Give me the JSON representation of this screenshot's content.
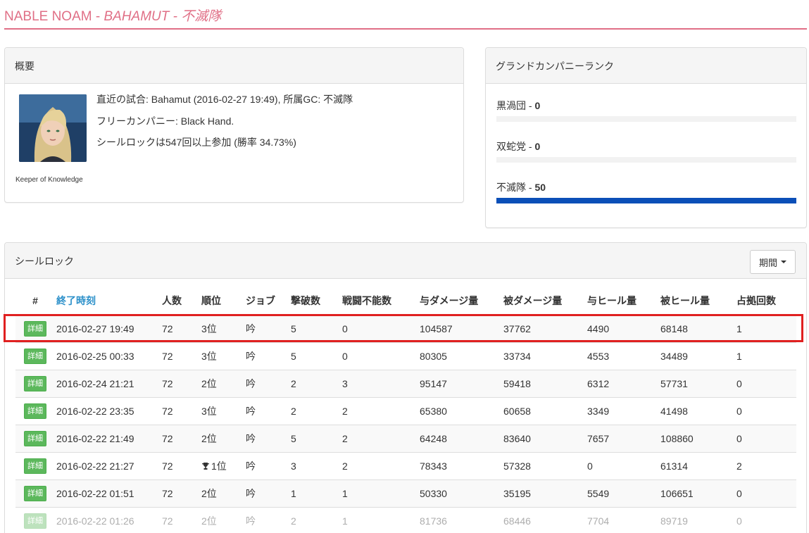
{
  "header": {
    "name": "NABLE NOAM - ",
    "datacenter": "BAHAMUT - 不滅隊"
  },
  "overview": {
    "title": "概要",
    "last_match": "直近の試合: Bahamut (2016-02-27 19:49), 所属GC: 不滅隊",
    "free_company": "フリーカンパニー: Black Hand.",
    "participation": "シールロックは547回以上参加 (勝率 34.73%)",
    "player_title": "Keeper of Knowledge"
  },
  "gc_rank": {
    "title": "グランドカンパニーランク",
    "items": [
      {
        "label": "黒渦団 - ",
        "value": "0",
        "fill": 0
      },
      {
        "label": "双蛇党 - ",
        "value": "0",
        "fill": 0
      },
      {
        "label": "不滅隊 - ",
        "value": "50",
        "fill": 1.0
      }
    ],
    "bar_color": "#0b4fb8"
  },
  "seal_rock": {
    "title": "シールロック",
    "period_label": "期間",
    "columns": [
      "#",
      "終了時刻",
      "人数",
      "順位",
      "ジョブ",
      "撃破数",
      "戦闘不能数",
      "与ダメージ量",
      "被ダメージ量",
      "与ヒール量",
      "被ヒール量",
      "占拠回数"
    ],
    "detail_label": "詳細",
    "rows": [
      {
        "time": "2016-02-27 19:49",
        "players": "72",
        "rank": "3位",
        "trophy": false,
        "job": "吟",
        "kills": "5",
        "deaths": "0",
        "dmg_dealt": "104587",
        "dmg_taken": "37762",
        "heal_dealt": "4490",
        "heal_taken": "68148",
        "captures": "1"
      },
      {
        "time": "2016-02-25 00:33",
        "players": "72",
        "rank": "3位",
        "trophy": false,
        "job": "吟",
        "kills": "5",
        "deaths": "0",
        "dmg_dealt": "80305",
        "dmg_taken": "33734",
        "heal_dealt": "4553",
        "heal_taken": "34489",
        "captures": "1"
      },
      {
        "time": "2016-02-24 21:21",
        "players": "72",
        "rank": "2位",
        "trophy": false,
        "job": "吟",
        "kills": "2",
        "deaths": "3",
        "dmg_dealt": "95147",
        "dmg_taken": "59418",
        "heal_dealt": "6312",
        "heal_taken": "57731",
        "captures": "0"
      },
      {
        "time": "2016-02-22 23:35",
        "players": "72",
        "rank": "3位",
        "trophy": false,
        "job": "吟",
        "kills": "2",
        "deaths": "2",
        "dmg_dealt": "65380",
        "dmg_taken": "60658",
        "heal_dealt": "3349",
        "heal_taken": "41498",
        "captures": "0"
      },
      {
        "time": "2016-02-22 21:49",
        "players": "72",
        "rank": "2位",
        "trophy": false,
        "job": "吟",
        "kills": "5",
        "deaths": "2",
        "dmg_dealt": "64248",
        "dmg_taken": "83640",
        "heal_dealt": "7657",
        "heal_taken": "108860",
        "captures": "0"
      },
      {
        "time": "2016-02-22 21:27",
        "players": "72",
        "rank": "1位",
        "trophy": true,
        "job": "吟",
        "kills": "3",
        "deaths": "2",
        "dmg_dealt": "78343",
        "dmg_taken": "57328",
        "heal_dealt": "0",
        "heal_taken": "61314",
        "captures": "2"
      },
      {
        "time": "2016-02-22 01:51",
        "players": "72",
        "rank": "2位",
        "trophy": false,
        "job": "吟",
        "kills": "1",
        "deaths": "1",
        "dmg_dealt": "50330",
        "dmg_taken": "35195",
        "heal_dealt": "5549",
        "heal_taken": "106651",
        "captures": "0"
      },
      {
        "time": "2016-02-22 01:26",
        "players": "72",
        "rank": "2位",
        "trophy": false,
        "job": "吟",
        "kills": "2",
        "deaths": "1",
        "dmg_dealt": "81736",
        "dmg_taken": "68446",
        "heal_dealt": "7704",
        "heal_taken": "89719",
        "captures": "0"
      }
    ]
  },
  "colors": {
    "accent": "#e06f86",
    "sorted_header": "#2a8fc9",
    "detail_button": "#5cb85c",
    "highlight": "#e02020"
  },
  "icons": {
    "trophy": "trophy-icon",
    "period_caret": "caret-down-icon"
  }
}
